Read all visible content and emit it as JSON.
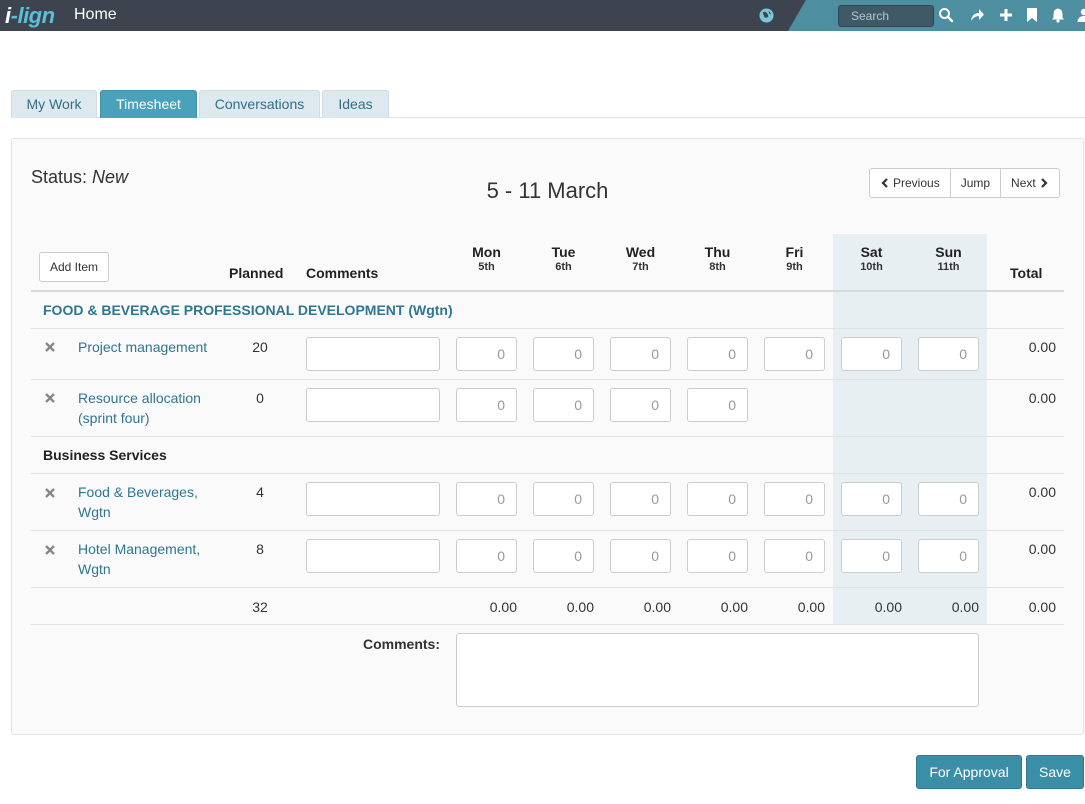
{
  "topbar": {
    "logo_main": "i",
    "logo_accent": "-lign",
    "page_title": "Home",
    "search_placeholder": "Search",
    "icons": [
      "globe-icon",
      "search-icon",
      "share-icon",
      "plus-icon",
      "bookmark-icon",
      "bell-icon",
      "user-icon"
    ],
    "colors": {
      "bar": "#3d4450",
      "accent": "#4d8ea1"
    }
  },
  "tabs": [
    {
      "label": "My Work",
      "active": false
    },
    {
      "label": "Timesheet",
      "active": true
    },
    {
      "label": "Conversations",
      "active": false
    },
    {
      "label": "Ideas",
      "active": false
    }
  ],
  "status": {
    "label": "Status:",
    "value": "New"
  },
  "week": {
    "range": "5 - 11 March",
    "prev_label": "Previous",
    "jump_label": "Jump",
    "next_label": "Next"
  },
  "table": {
    "add_item_label": "Add Item",
    "headers": {
      "planned": "Planned",
      "comments": "Comments",
      "total": "Total"
    },
    "days": [
      {
        "name": "Mon",
        "date": "5th"
      },
      {
        "name": "Tue",
        "date": "6th"
      },
      {
        "name": "Wed",
        "date": "7th"
      },
      {
        "name": "Thu",
        "date": "8th"
      },
      {
        "name": "Fri",
        "date": "9th"
      },
      {
        "name": "Sat",
        "date": "10th"
      },
      {
        "name": "Sun",
        "date": "11th"
      }
    ],
    "groups": [
      {
        "title": "FOOD & BEVERAGE PROFESSIONAL DEVELOPMENT (Wgtn)",
        "items": [
          {
            "name_line1": "Project management",
            "name_line2": "",
            "planned": "20",
            "hours": [
              "0",
              "0",
              "0",
              "0",
              "0",
              "0",
              "0"
            ],
            "total": "0.00"
          },
          {
            "name_line1": "Resource allocation",
            "name_line2": "(sprint four)",
            "planned": "0",
            "hours": [
              "0",
              "0",
              "0",
              "0"
            ],
            "total": "0.00"
          }
        ]
      },
      {
        "title": "Business Services",
        "items": [
          {
            "name_line1": "Food & Beverages,",
            "name_line2": "Wgtn",
            "planned": "4",
            "hours": [
              "0",
              "0",
              "0",
              "0",
              "0",
              "0",
              "0"
            ],
            "total": "0.00"
          },
          {
            "name_line1": "Hotel Management,",
            "name_line2": "Wgtn",
            "planned": "8",
            "hours": [
              "0",
              "0",
              "0",
              "0",
              "0",
              "0",
              "0"
            ],
            "total": "0.00"
          }
        ]
      }
    ],
    "footer": {
      "planned_total": "32",
      "day_totals": [
        "0.00",
        "0.00",
        "0.00",
        "0.00",
        "0.00",
        "0.00",
        "0.00"
      ],
      "grand_total": "0.00"
    }
  },
  "comments_section": {
    "label": "Comments:",
    "value": ""
  },
  "actions": {
    "for_approval_label": "For Approval",
    "save_label": "Save"
  }
}
